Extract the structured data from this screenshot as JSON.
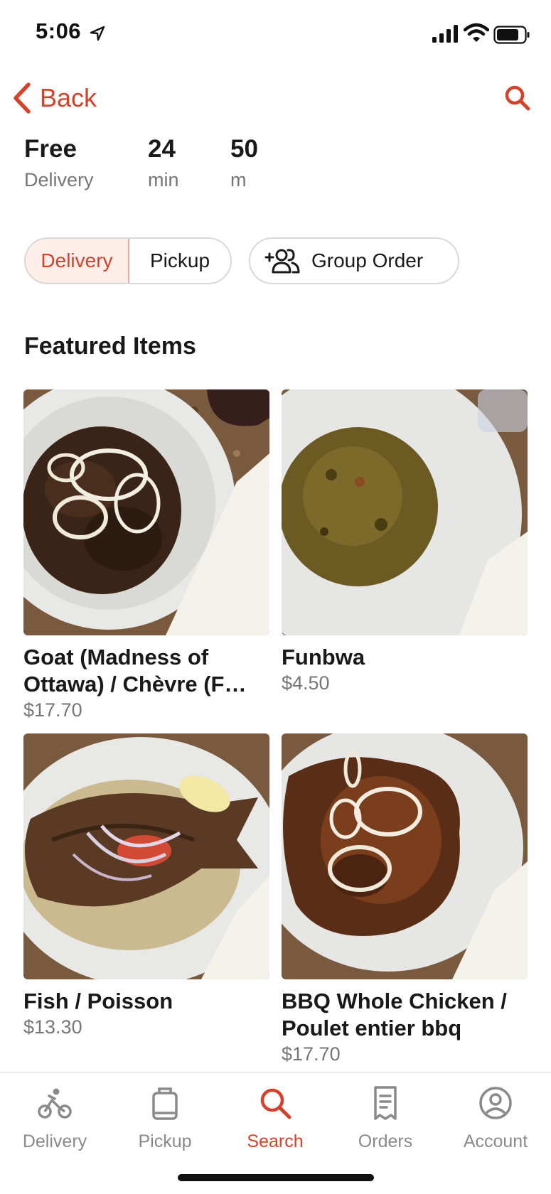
{
  "status_bar": {
    "time": "5:06"
  },
  "nav": {
    "back_label": "Back"
  },
  "stats": [
    {
      "value": "Free",
      "label": "Delivery"
    },
    {
      "value": "24",
      "label": "min"
    },
    {
      "value": "50",
      "label": "m"
    }
  ],
  "mode_toggle": {
    "delivery_label": "Delivery",
    "pickup_label": "Pickup",
    "selected": "Delivery"
  },
  "group_order": {
    "label": "Group Order"
  },
  "featured": {
    "title": "Featured Items",
    "items": [
      {
        "name": "Goat (Madness of Ottawa) / Chèvre (F…",
        "price": "$17.70"
      },
      {
        "name": "Funbwa",
        "price": "$4.50"
      },
      {
        "name": "Fish / Poisson",
        "price": "$13.30"
      },
      {
        "name": "BBQ Whole Chicken / Poulet entier bbq",
        "price": "$17.70"
      }
    ]
  },
  "tab_bar": {
    "tabs": [
      {
        "label": "Delivery",
        "icon": "bike-icon"
      },
      {
        "label": "Pickup",
        "icon": "bag-icon"
      },
      {
        "label": "Search",
        "icon": "search-icon"
      },
      {
        "label": "Orders",
        "icon": "receipt-icon"
      },
      {
        "label": "Account",
        "icon": "account-icon"
      }
    ],
    "active": "Search"
  },
  "colors": {
    "accent": "#d6412a",
    "accent_light": "#fdeeea",
    "text": "#191919",
    "muted": "#767676",
    "tab_inactive": "#8a8a8a"
  }
}
